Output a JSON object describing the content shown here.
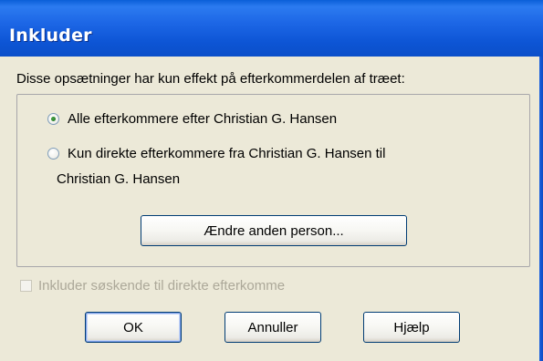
{
  "window": {
    "title": "Inkluder"
  },
  "intro_text": "Disse opsætninger har kun effekt på efterkommerdelen af træet:",
  "options": {
    "radio_all": "Alle efterkommere efter Christian G. Hansen",
    "radio_direct_line1": "Kun direkte efterkommere fra Christian G. Hansen til",
    "radio_direct_line2": "Christian G. Hansen",
    "selected": "radio_all",
    "change_person_button": "Ændre anden person..."
  },
  "include_siblings": {
    "label": "Inkluder søskende til direkte efterkomme",
    "checked": false,
    "enabled": false
  },
  "buttons": {
    "ok": "OK",
    "cancel": "Annuller",
    "help": "Hjælp"
  }
}
